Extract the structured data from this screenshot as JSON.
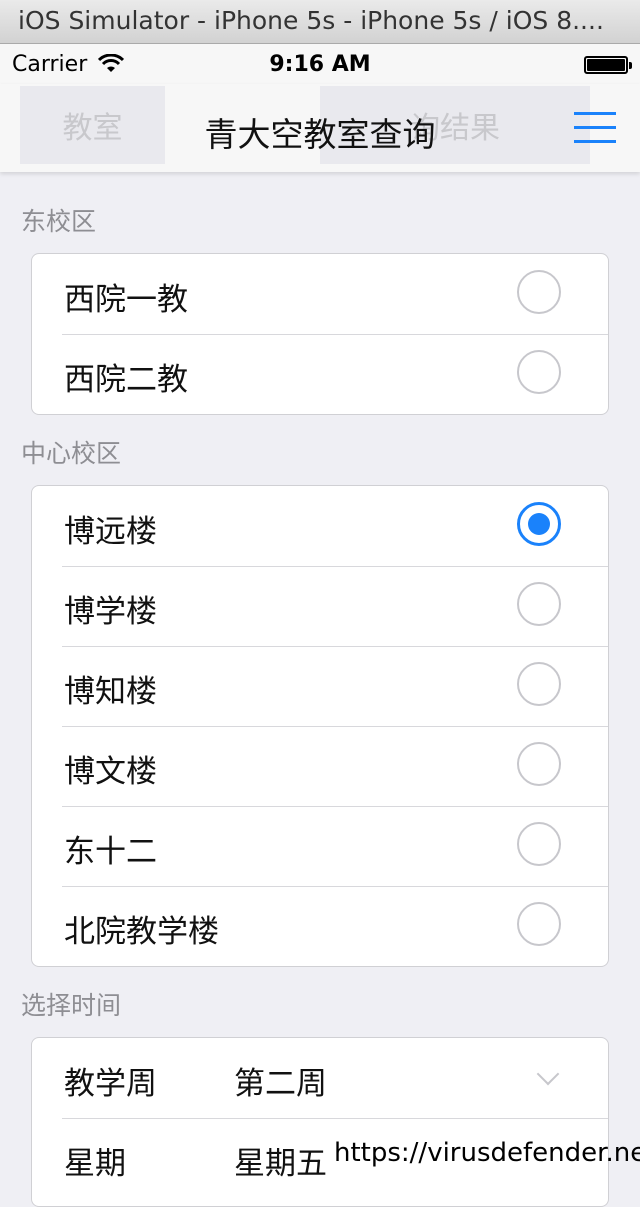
{
  "simulator": {
    "title": "iOS Simulator - iPhone 5s - iPhone 5s / iOS 8...."
  },
  "statusbar": {
    "carrier": "Carrier",
    "time": "9:16 AM",
    "wifi_icon": "wifi-icon",
    "battery_icon": "battery-icon"
  },
  "navbar": {
    "title": "青大空教室查询",
    "ghost_left": "教室",
    "ghost_right": "询结果",
    "menu_icon": "menu-icon"
  },
  "sections": {
    "east": {
      "header": "东校区",
      "items": [
        {
          "label": "西院一教",
          "selected": false
        },
        {
          "label": "西院二教",
          "selected": false
        }
      ]
    },
    "center": {
      "header": "中心校区",
      "items": [
        {
          "label": "博远楼",
          "selected": true
        },
        {
          "label": "博学楼",
          "selected": false
        },
        {
          "label": "博知楼",
          "selected": false
        },
        {
          "label": "博文楼",
          "selected": false
        },
        {
          "label": "东十二",
          "selected": false
        },
        {
          "label": "北院教学楼",
          "selected": false
        }
      ]
    },
    "time": {
      "header": "选择时间",
      "rows": [
        {
          "label": "教学周",
          "value": "第二周",
          "icon": "chevron-down-icon"
        },
        {
          "label": "星期",
          "value": "星期五"
        }
      ]
    }
  },
  "watermark": "https://virusdefender.net",
  "colors": {
    "accent": "#1a82fb",
    "background": "#efeff4",
    "separator": "#d8d8dc",
    "section_header": "#8e8e93"
  }
}
